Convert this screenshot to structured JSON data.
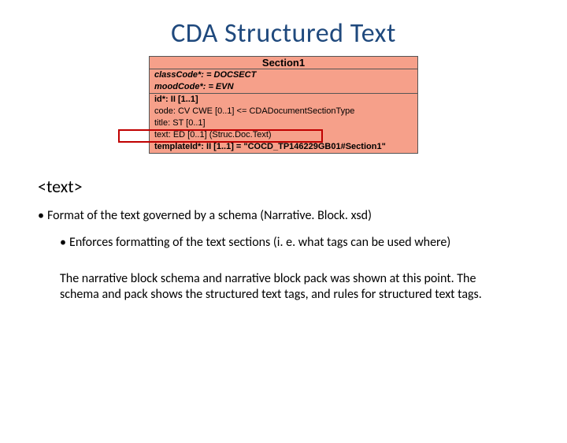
{
  "title": "CDA Structured Text",
  "diagram": {
    "header": "Section1",
    "rows": [
      {
        "text": "classCode*: = DOCSECT",
        "bold": true,
        "italic": true
      },
      {
        "text": "moodCode*: = EVN",
        "bold": true,
        "italic": true
      }
    ],
    "rows2": [
      {
        "text": "id*: II [1..1]",
        "bold": true
      },
      {
        "text": "code: CV CWE [0..1] <= CDADocumentSectionType",
        "bold": false
      },
      {
        "text": "title: ST [0..1]",
        "bold": false
      },
      {
        "text": "text: ED [0..1] (Struc.Doc.Text)",
        "bold": false
      },
      {
        "text": "templateId*: II [1..1] = \"COCD_TP146229GB01#Section1\"",
        "bold": true
      }
    ]
  },
  "text_tag": "<text>",
  "bullet1": "Format of the text governed by a schema (Narrative. Block. xsd)",
  "bullet2": "Enforces formatting of the text sections (i. e. what tags can be used where)",
  "para": "The narrative block schema and narrative block pack was shown at this point. The schema and pack shows the structured text tags, and rules for structured text tags."
}
